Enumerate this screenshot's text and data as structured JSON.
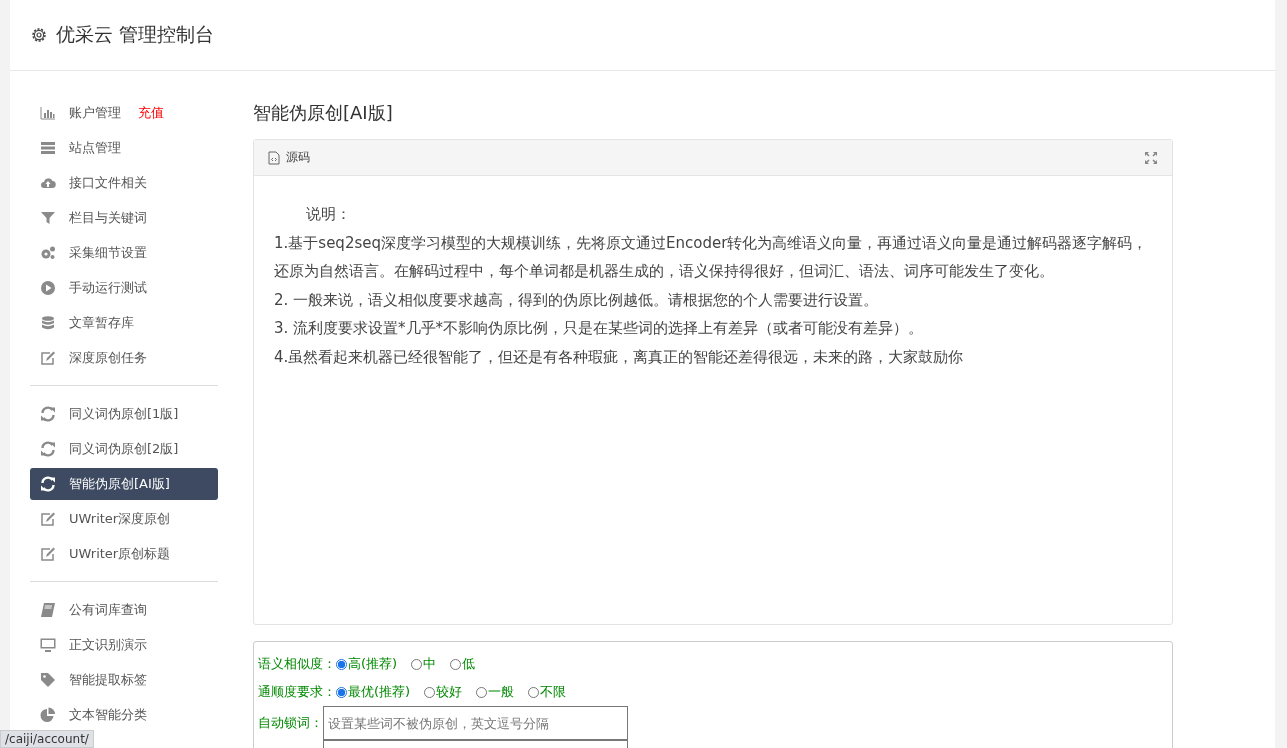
{
  "header": {
    "title": "优采云 管理控制台"
  },
  "sidebar": {
    "groups": [
      {
        "items": [
          {
            "label": "账户管理",
            "badge": "充值",
            "kind": "chart",
            "selected": false
          },
          {
            "label": "站点管理",
            "kind": "server",
            "selected": false
          },
          {
            "label": "接口文件相关",
            "kind": "cloud",
            "selected": false
          },
          {
            "label": "栏目与关键词",
            "kind": "filter",
            "selected": false
          },
          {
            "label": "采集细节设置",
            "kind": "gears",
            "selected": false
          },
          {
            "label": "手动运行测试",
            "kind": "play",
            "selected": false
          },
          {
            "label": "文章暂存库",
            "kind": "database",
            "selected": false
          },
          {
            "label": "深度原创任务",
            "kind": "edit",
            "selected": false
          }
        ]
      },
      {
        "items": [
          {
            "label": "同义词伪原创[1版]",
            "kind": "refresh",
            "selected": false
          },
          {
            "label": "同义词伪原创[2版]",
            "kind": "refresh",
            "selected": false
          },
          {
            "label": "智能伪原创[AI版]",
            "kind": "refresh",
            "selected": true
          },
          {
            "label": "UWriter深度原创",
            "kind": "edit",
            "selected": false
          },
          {
            "label": "UWriter原创标题",
            "kind": "edit",
            "selected": false
          }
        ]
      },
      {
        "items": [
          {
            "label": "公有词库查询",
            "kind": "book",
            "selected": false
          },
          {
            "label": "正文识别演示",
            "kind": "monitor",
            "selected": false
          },
          {
            "label": "智能提取标签",
            "kind": "tag",
            "selected": false
          },
          {
            "label": "文本智能分类",
            "kind": "pie",
            "selected": false
          }
        ]
      }
    ]
  },
  "page_title": "智能伪原创[AI版]",
  "editor": {
    "tab": "源码",
    "heading": "说明：",
    "lines": [
      "1.基于seq2seq深度学习模型的大规模训练，先将原文通过Encoder转化为高维语义向量，再通过语义向量是通过解码器逐字解码，还原为自然语言。在解码过程中，每个单词都是机器生成的，语义保持得很好，但词汇、语法、词序可能发生了变化。",
      "2. 一般来说，语义相似度要求越高，得到的伪原比例越低。请根据您的个人需要进行设置。",
      "3. 流利度要求设置*几乎*不影响伪原比例，只是在某些词的选择上有差异（或者可能没有差异）。",
      "4.虽然看起来机器已经很智能了，但还是有各种瑕疵，离真正的智能还差得很远，未来的路，大家鼓励你"
    ]
  },
  "options": [
    {
      "label": "语义相似度：",
      "choices": [
        {
          "label": "高(推荐)",
          "selected": true
        },
        {
          "label": "中",
          "selected": false
        },
        {
          "label": "低",
          "selected": false
        }
      ]
    },
    {
      "label": "通顺度要求：",
      "choices": [
        {
          "label": "最优(推荐)",
          "selected": true
        },
        {
          "label": "较好",
          "selected": false
        },
        {
          "label": "一般",
          "selected": false
        },
        {
          "label": "不限",
          "selected": false
        }
      ]
    }
  ],
  "lock_words": {
    "label": "自动锁词：",
    "placeholder": "设置某些词不被伪原创，英文逗号分隔"
  },
  "status_bar": {
    "url": "/caiji/account/"
  }
}
